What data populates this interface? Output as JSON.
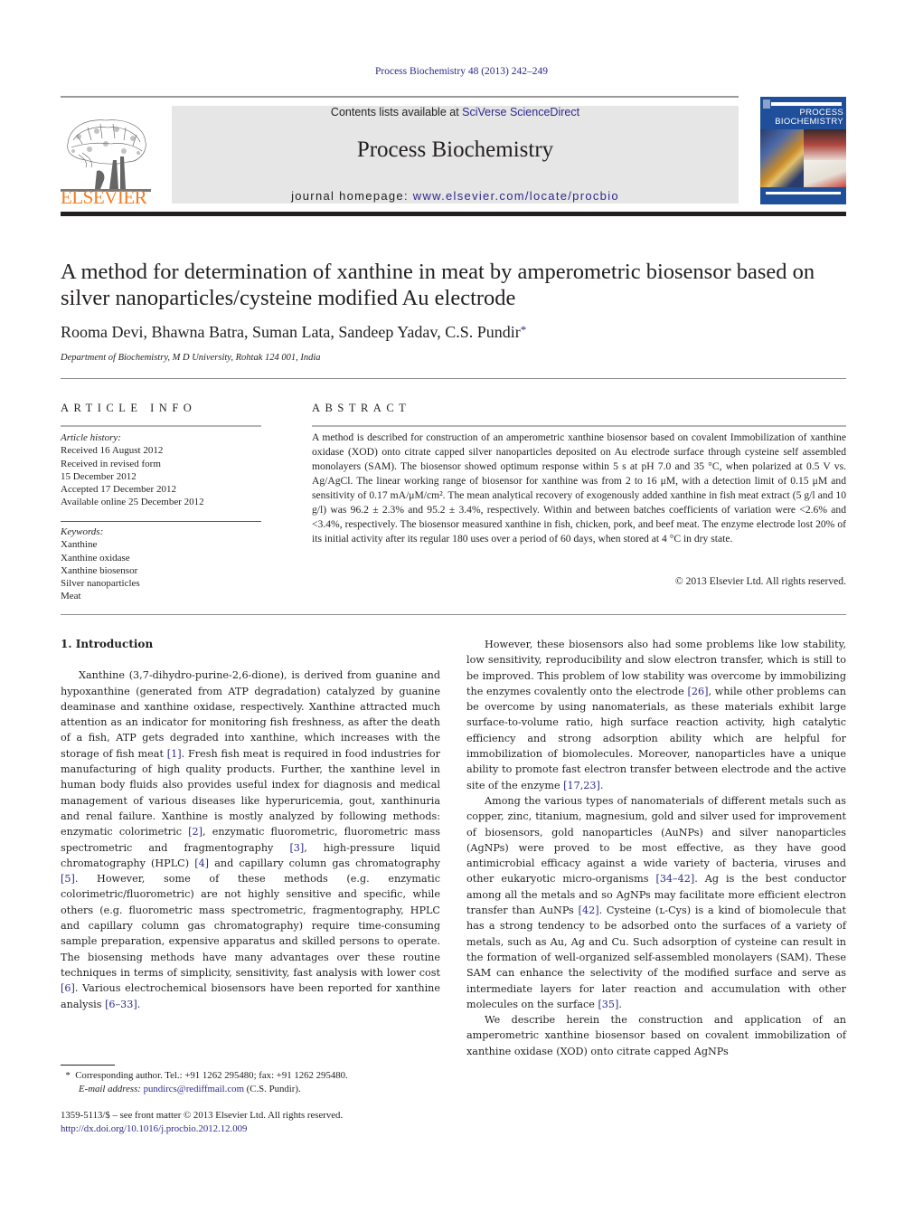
{
  "header": {
    "journal_ref": "Process Biochemistry 48 (2013) 242–249",
    "contents_prefix": "Contents lists available at ",
    "contents_link": "SciVerse ScienceDirect",
    "journal_title": "Process Biochemistry",
    "homepage_prefix": "journal homepage: ",
    "homepage_link": "www.elsevier.com/locate/procbio",
    "publisher_logo_text": "ELSEVIER",
    "cover_title_line1": "PROCESS",
    "cover_title_line2": "BIOCHEMISTRY",
    "colors": {
      "link": "#2e2a8c",
      "elsevier_orange": "#f47b20",
      "masthead_bg": "#e6e6e6",
      "cover_blue": "#1f4f9b"
    }
  },
  "article": {
    "title": "A method for determination of xanthine in meat by amperometric biosensor based on silver nanoparticles/cysteine modified Au electrode",
    "authors": "Rooma Devi, Bhawna Batra, Suman Lata, Sandeep Yadav, C.S. Pundir",
    "corresponding_mark": "*",
    "affiliation": "Department of Biochemistry, M D University, Rohtak 124 001, India"
  },
  "article_info": {
    "heading": "ARTICLE INFO",
    "history_label": "Article history:",
    "history": [
      "Received 16 August 2012",
      "Received in revised form",
      "15 December 2012",
      "Accepted 17 December 2012",
      "Available online 25 December 2012"
    ],
    "keywords_label": "Keywords:",
    "keywords": [
      "Xanthine",
      "Xanthine oxidase",
      "Xanthine biosensor",
      "Silver nanoparticles",
      "Meat"
    ]
  },
  "abstract": {
    "heading": "ABSTRACT",
    "text": "A method is described for construction of an amperometric xanthine biosensor based on covalent Immobilization of xanthine oxidase (XOD) onto citrate capped silver nanoparticles deposited on Au electrode surface through cysteine self assembled monolayers (SAM). The biosensor showed optimum response within 5 s at pH 7.0 and 35 °C, when polarized at 0.5 V vs. Ag/AgCl. The linear working range of biosensor for xanthine was from 2 to 16 μM, with a detection limit of 0.15 μM and sensitivity of 0.17 mA/μM/cm². The mean analytical recovery of exogenously added xanthine in fish meat extract (5 g/l and 10 g/l) was 96.2 ± 2.3% and 95.2 ± 3.4%, respectively. Within and between batches coefficients of variation were <2.6% and <3.4%, respectively. The biosensor measured xanthine in fish, chicken, pork, and beef meat. The enzyme electrode lost 20% of its initial activity after its regular 180 uses over a period of 60 days, when stored at 4 °C in dry state.",
    "copyright": "© 2013 Elsevier Ltd. All rights reserved."
  },
  "body": {
    "section_heading": "1.  Introduction",
    "left_paragraphs": [
      [
        {
          "t": "Xanthine (3,7-dihydro-purine-2,6-dione), is derived from guanine and hypoxanthine (generated from ATP degradation) catalyzed by guanine deaminase and xanthine oxidase, respectively. Xanthine attracted much attention as an indicator for monitoring fish freshness, as after the death of a fish, ATP gets degraded into xanthine, which increases with the storage of fish meat "
        },
        {
          "c": "[1]"
        },
        {
          "t": ". Fresh fish meat is required in food industries for manufacturing of high quality products. Further, the xanthine level in human body fluids also provides useful index for diagnosis and medical management of various diseases like hyperuricemia, gout, xanthinuria and renal failure. Xanthine is mostly analyzed by following methods: enzymatic colorimetric "
        },
        {
          "c": "[2]"
        },
        {
          "t": ", enzymatic fluorometric, fluorometric mass spectrometric and fragmentography "
        },
        {
          "c": "[3]"
        },
        {
          "t": ", high-pressure liquid chromatography (HPLC) "
        },
        {
          "c": "[4]"
        },
        {
          "t": " and capillary column gas chromatography "
        },
        {
          "c": "[5]"
        },
        {
          "t": ". However, some of these methods (e.g. enzymatic colorimetric/fluorometric) are not highly sensitive and specific, while others (e.g. fluorometric mass spectrometric, fragmentography, HPLC and capillary column gas chromatography) require time-consuming sample preparation, expensive apparatus and skilled persons to operate. The biosensing methods have many advantages over these routine techniques in terms of simplicity, sensitivity, fast analysis with lower cost "
        },
        {
          "c": "[6]"
        },
        {
          "t": ". Various electrochemical biosensors have been reported for xanthine analysis "
        },
        {
          "c": "[6–33]"
        },
        {
          "t": "."
        }
      ]
    ],
    "right_paragraphs": [
      [
        {
          "t": "However, these biosensors also had some problems like low stability, low sensitivity, reproducibility and slow electron transfer, which is still to be improved. This problem of low stability was overcome by immobilizing the enzymes covalently onto the electrode "
        },
        {
          "c": "[26]"
        },
        {
          "t": ", while other problems can be overcome by using nanomaterials, as these materials exhibit large surface-to-volume ratio, high surface reaction activity, high catalytic efficiency and strong adsorption ability which are helpful for immobilization of biomolecules. Moreover, nanoparticles have a unique ability to promote fast electron transfer between electrode and the active site of the enzyme "
        },
        {
          "c": "[17,23]"
        },
        {
          "t": "."
        }
      ],
      [
        {
          "t": "Among the various types of nanomaterials of different metals such as copper, zinc, titanium, magnesium, gold and silver used for improvement of biosensors, gold nanoparticles (AuNPs) and silver nanoparticles (AgNPs) were proved to be most effective, as they have good antimicrobial efficacy against a wide variety of bacteria, viruses and other eukaryotic micro-organisms "
        },
        {
          "c": "[34–42]"
        },
        {
          "t": ". Ag is the best conductor among all the metals and so AgNPs may facilitate more efficient electron transfer than AuNPs "
        },
        {
          "c": "[42]"
        },
        {
          "t": ". Cysteine (ʟ-Cys) is a kind of biomolecule that has a strong tendency to be adsorbed onto the surfaces of a variety of metals, such as Au, Ag and Cu. Such adsorption of cysteine can result in the formation of well-organized self-assembled monolayers (SAM). These SAM can enhance the selectivity of the modified surface and serve as intermediate layers for later reaction and accumulation with other molecules on the surface "
        },
        {
          "c": "[35]"
        },
        {
          "t": "."
        }
      ],
      [
        {
          "t": "We describe herein the construction and application of an amperometric xanthine biosensor based on covalent immobilization of xanthine oxidase (XOD) onto citrate capped AgNPs"
        }
      ]
    ]
  },
  "footnote": {
    "mark": "*",
    "corresponding": "Corresponding author. Tel.: +91 1262 295480; fax: +91 1262 295480.",
    "email_label": "E-mail address:",
    "email": "pundircs@rediffmail.com",
    "email_suffix": " (C.S. Pundir)."
  },
  "front_matter": {
    "issn_line": "1359-5113/$ – see front matter © 2013 Elsevier Ltd. All rights reserved.",
    "doi": "http://dx.doi.org/10.1016/j.procbio.2012.12.009"
  }
}
